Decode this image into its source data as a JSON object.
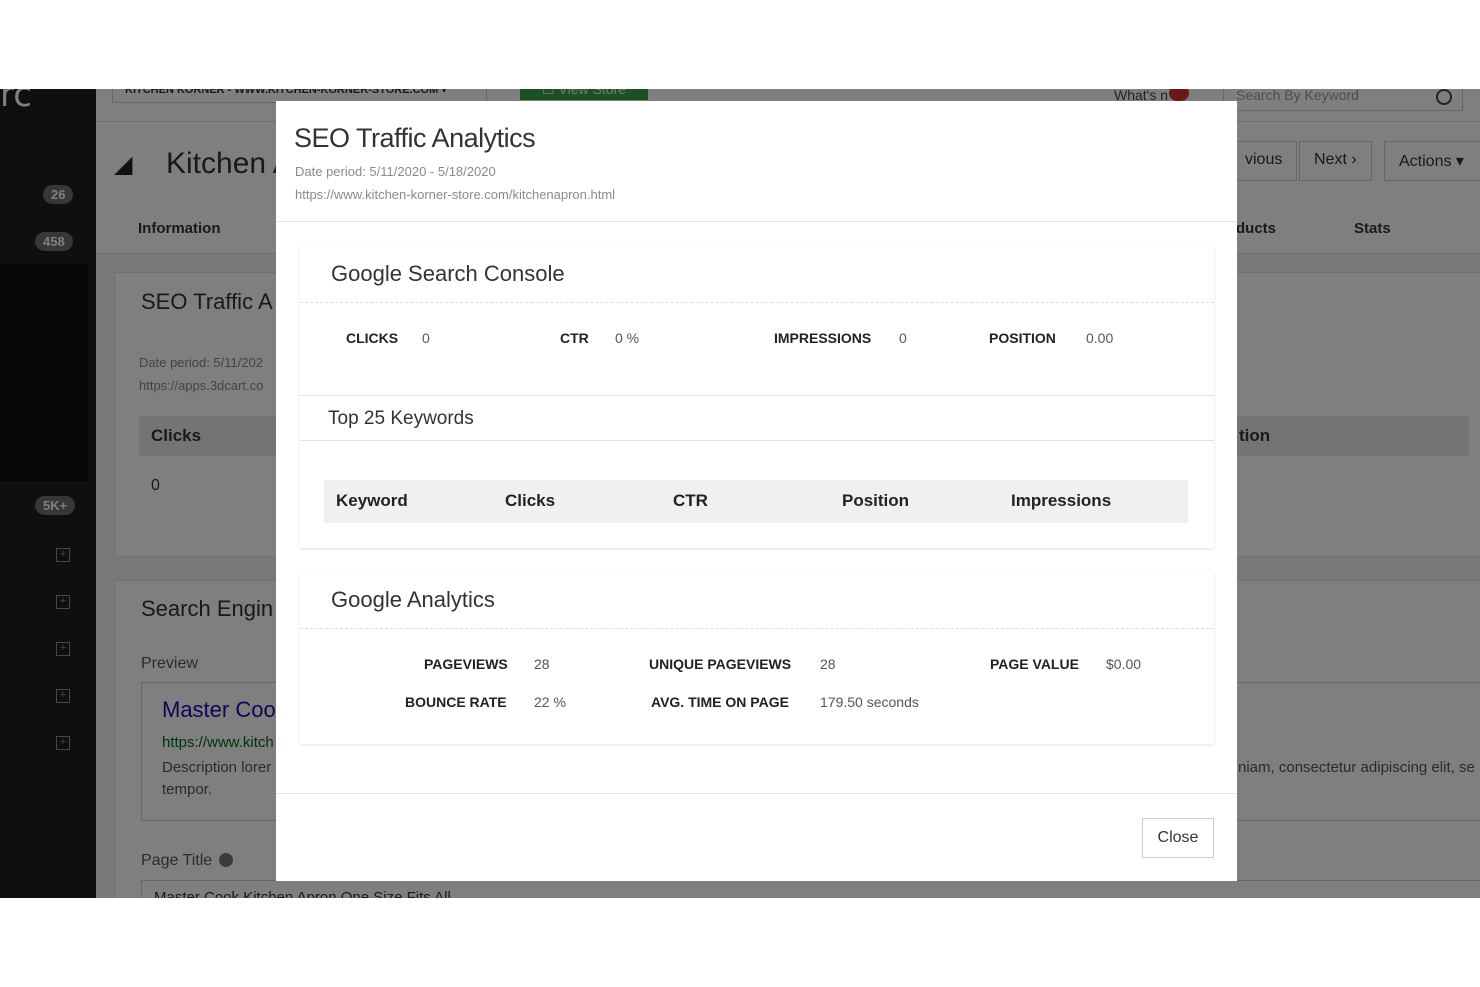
{
  "background": {
    "logo_text": "rc",
    "badges": [
      "26",
      "458",
      "5K+"
    ],
    "store_selector": "KITCHEN KORNER - WWW.KITCHEN-KORNER-STORE.COM ▾",
    "view_store": "☐ View Store",
    "whats_new": "What's n",
    "search_placeholder": "Search By Keyword",
    "page_title": "Kitchen A",
    "previous_btn": "vious",
    "next_btn": "Next ›",
    "actions_btn": "Actions ▾",
    "tabs": [
      "Information",
      "ducts",
      "Stats"
    ],
    "seo_card_title": "SEO Traffic A",
    "seo_date": "Date period: 5/11/202",
    "seo_url": "https://apps.3dcart.co",
    "clicks_header": "Clicks",
    "position_header": "tion",
    "clicks_value": "0",
    "search_engine_title": "Search Engin",
    "preview_label": "Preview",
    "preview_link": "Master Cool",
    "preview_url": "https://www.kitch",
    "preview_desc_1": "Description lorer",
    "preview_desc_2": "tempor.",
    "preview_desc_right": "niam, consectetur adipiscing elit, se",
    "page_title_label": "Page Title",
    "page_title_value": "Master Cook Kitchen Apron One Size Fits All"
  },
  "modal": {
    "title": "SEO Traffic Analytics",
    "date_period": "Date period: 5/11/2020 - 5/18/2020",
    "url": "https://www.kitchen-korner-store.com/kitchenapron.html",
    "search_console": {
      "title": "Google Search Console",
      "metrics": [
        {
          "label": "CLICKS",
          "value": "0"
        },
        {
          "label": "CTR",
          "value": "0 %"
        },
        {
          "label": "IMPRESSIONS",
          "value": "0"
        },
        {
          "label": "POSITION",
          "value": "0.00"
        }
      ],
      "keywords_title": "Top 25 Keywords",
      "keyword_columns": [
        "Keyword",
        "Clicks",
        "CTR",
        "Position",
        "Impressions"
      ]
    },
    "analytics": {
      "title": "Google Analytics",
      "pageviews_label": "PAGEVIEWS",
      "pageviews_value": "28",
      "unique_label": "UNIQUE PAGEVIEWS",
      "unique_value": "28",
      "page_value_label": "PAGE VALUE",
      "page_value_value": "$0.00",
      "bounce_label": "BOUNCE RATE",
      "bounce_value": "22 %",
      "avg_time_label": "AVG. TIME ON PAGE",
      "avg_time_value": "179.50 seconds"
    },
    "close_label": "Close"
  }
}
